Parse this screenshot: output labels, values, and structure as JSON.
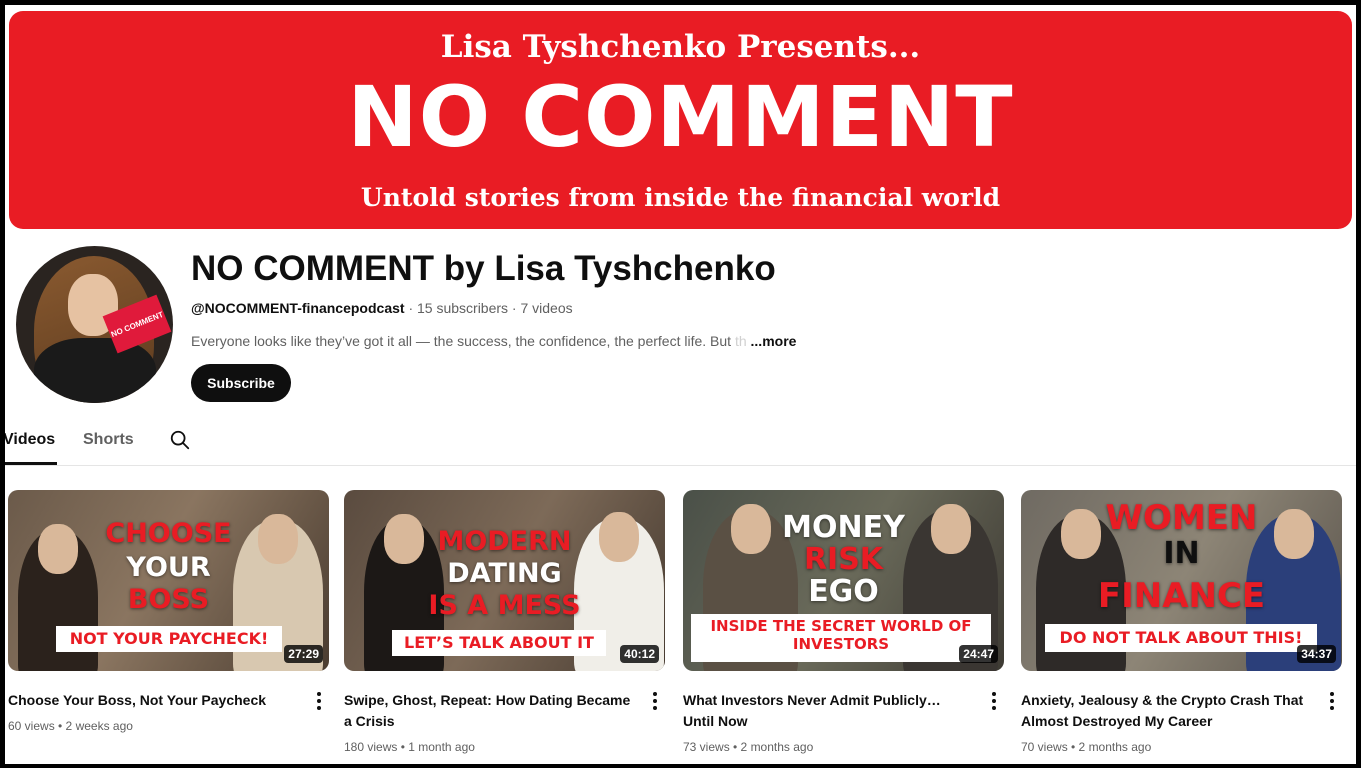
{
  "colors": {
    "accent": "#e91c24",
    "text": "#0f0f0f",
    "muted": "#606060"
  },
  "banner": {
    "presents": "Lisa Tyshchenko Presents...",
    "title": "NO COMMENT",
    "tagline": "Untold stories from inside the financial world"
  },
  "channel": {
    "avatar_card": "NO COMMENT",
    "name": "NO COMMENT by Lisa Tyshchenko",
    "handle": "@NOCOMMENT-financepodcast",
    "stats": " · 15 subscribers · 7 videos",
    "description": "Everyone looks like they’ve got it all — the success, the confidence, the perfect life. But ",
    "description_fade": "th",
    "more": "...more",
    "subscribe_label": "Subscribe"
  },
  "tabs": {
    "videos": "Videos",
    "shorts": "Shorts",
    "search_icon": "search-icon"
  },
  "videos": [
    {
      "lines": [
        "CHOOSE",
        "YOUR",
        "BOSS"
      ],
      "strip": "NOT YOUR PAYCHECK!",
      "duration": "27:29",
      "title": "Choose Your Boss, Not Your Paycheck",
      "meta": "60 views • 2 weeks ago"
    },
    {
      "lines": [
        "MODERN",
        "DATING",
        "IS A MESS"
      ],
      "strip": "LET’S TALK ABOUT IT",
      "duration": "40:12",
      "title": "Swipe, Ghost, Repeat: How Dating Became a Crisis",
      "meta": "180 views • 1 month ago"
    },
    {
      "lines": [
        "MONEY",
        "RISK",
        "EGO"
      ],
      "strip": "INSIDE THE SECRET WORLD OF INVESTORS",
      "duration": "24:47",
      "title": "What Investors Never Admit Publicly… Until Now",
      "meta": "73 views • 2 months ago"
    },
    {
      "lines": [
        "WOMEN",
        "IN",
        "FINANCE"
      ],
      "strip": "DO NOT TALK ABOUT THIS!",
      "duration": "34:37",
      "title": "Anxiety, Jealousy & the Crypto Crash That Almost Destroyed My Career",
      "meta": "70 views • 2 months ago"
    }
  ]
}
